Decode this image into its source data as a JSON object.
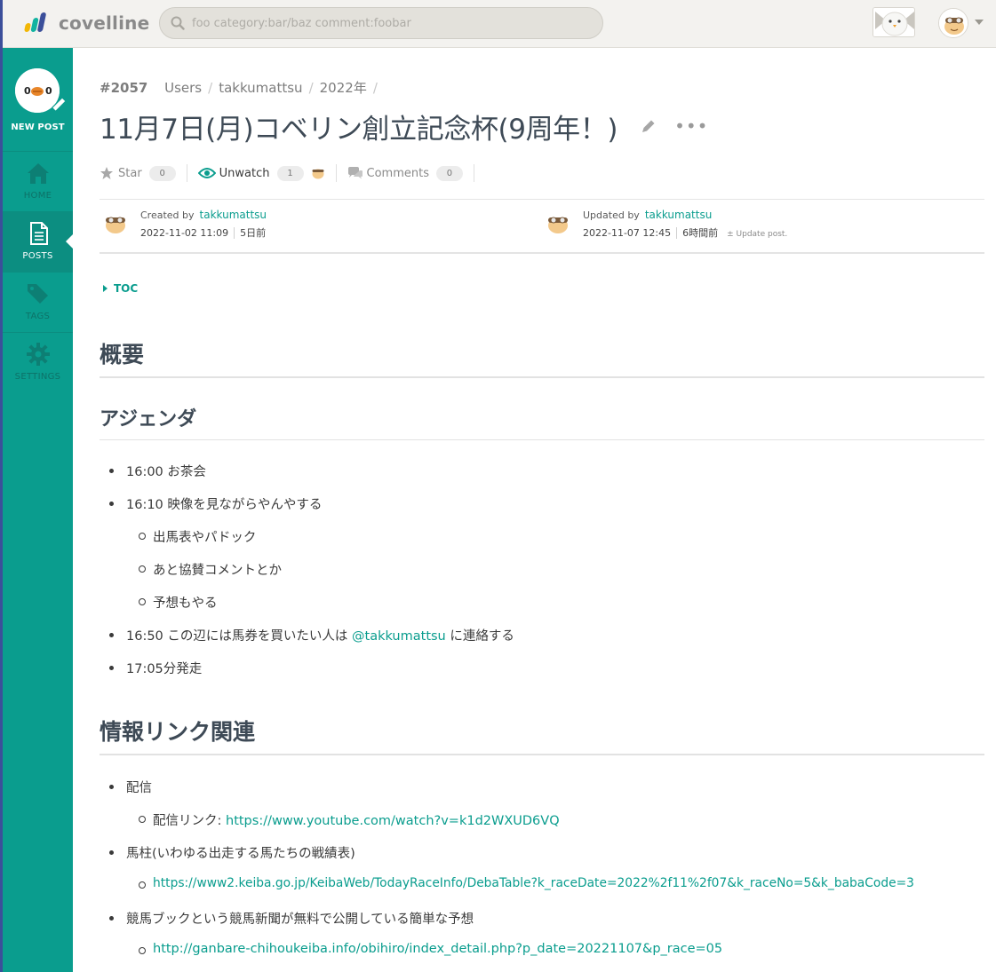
{
  "app": {
    "logo_text": "covelline"
  },
  "search": {
    "placeholder": "foo category:bar/baz comment:foobar"
  },
  "sidebar": {
    "new_post": "NEW POST",
    "items": [
      {
        "label": "HOME"
      },
      {
        "label": "POSTS"
      },
      {
        "label": "TAGS"
      },
      {
        "label": "SETTINGS"
      }
    ]
  },
  "breadcrumb": {
    "number": "#2057",
    "crumbs": [
      "Users",
      "takkumattsu",
      "2022年"
    ]
  },
  "post": {
    "title": "11月7日(月)コベリン創立記念杯(9周年！)",
    "more": "•••",
    "star_label": "Star",
    "star_count": "0",
    "watch_label": "Unwatch",
    "watch_count": "1",
    "comments_label": "Comments",
    "comments_count": "0"
  },
  "meta": {
    "created_label": "Created by",
    "created_user": "takkumattsu",
    "created_date": "2022-11-02 11:09",
    "created_ago": "5日前",
    "updated_label": "Updated by",
    "updated_user": "takkumattsu",
    "updated_date": "2022-11-07 12:45",
    "updated_ago": "6時間前",
    "update_post": "± Update post."
  },
  "content": {
    "toc": "TOC",
    "h_overview": "概要",
    "h_agenda": "アジェンダ",
    "agenda": {
      "i1": "16:00 お茶会",
      "i2": "16:10 映像を見ながらやんやする",
      "i2a": "出馬表やパドック",
      "i2b": "あと協賛コメントとか",
      "i2c": "予想もやる",
      "i3_pre": "16:50 この辺には馬券を買いたい人は ",
      "i3_mention": "@takkumattsu",
      "i3_post": " に連絡する",
      "i4": "17:05分発走"
    },
    "h_links": "情報リンク関連",
    "links": {
      "l1": "配信",
      "l1a_pre": "配信リンク: ",
      "l1a_url": "https://www.youtube.com/watch?v=k1d2WXUD6VQ",
      "l2": "馬柱(いわゆる出走する馬たちの戦績表)",
      "l2a_url": "https://www2.keiba.go.jp/KeibaWeb/TodayRaceInfo/DebaTable?k_raceDate=2022%2f11%2f07&k_raceNo=5&k_babaCode=3",
      "l3": "競馬ブックという競馬新聞が無料で公開している簡単な予想",
      "l3a_url": "http://ganbare-chihoukeiba.info/obihiro/index_detail.php?p_date=20221107&p_race=05"
    }
  },
  "colors": {
    "accent": "#0a9d8e",
    "sidebar": "#0a9d8e",
    "logo_blue": "#3b4f9a"
  }
}
